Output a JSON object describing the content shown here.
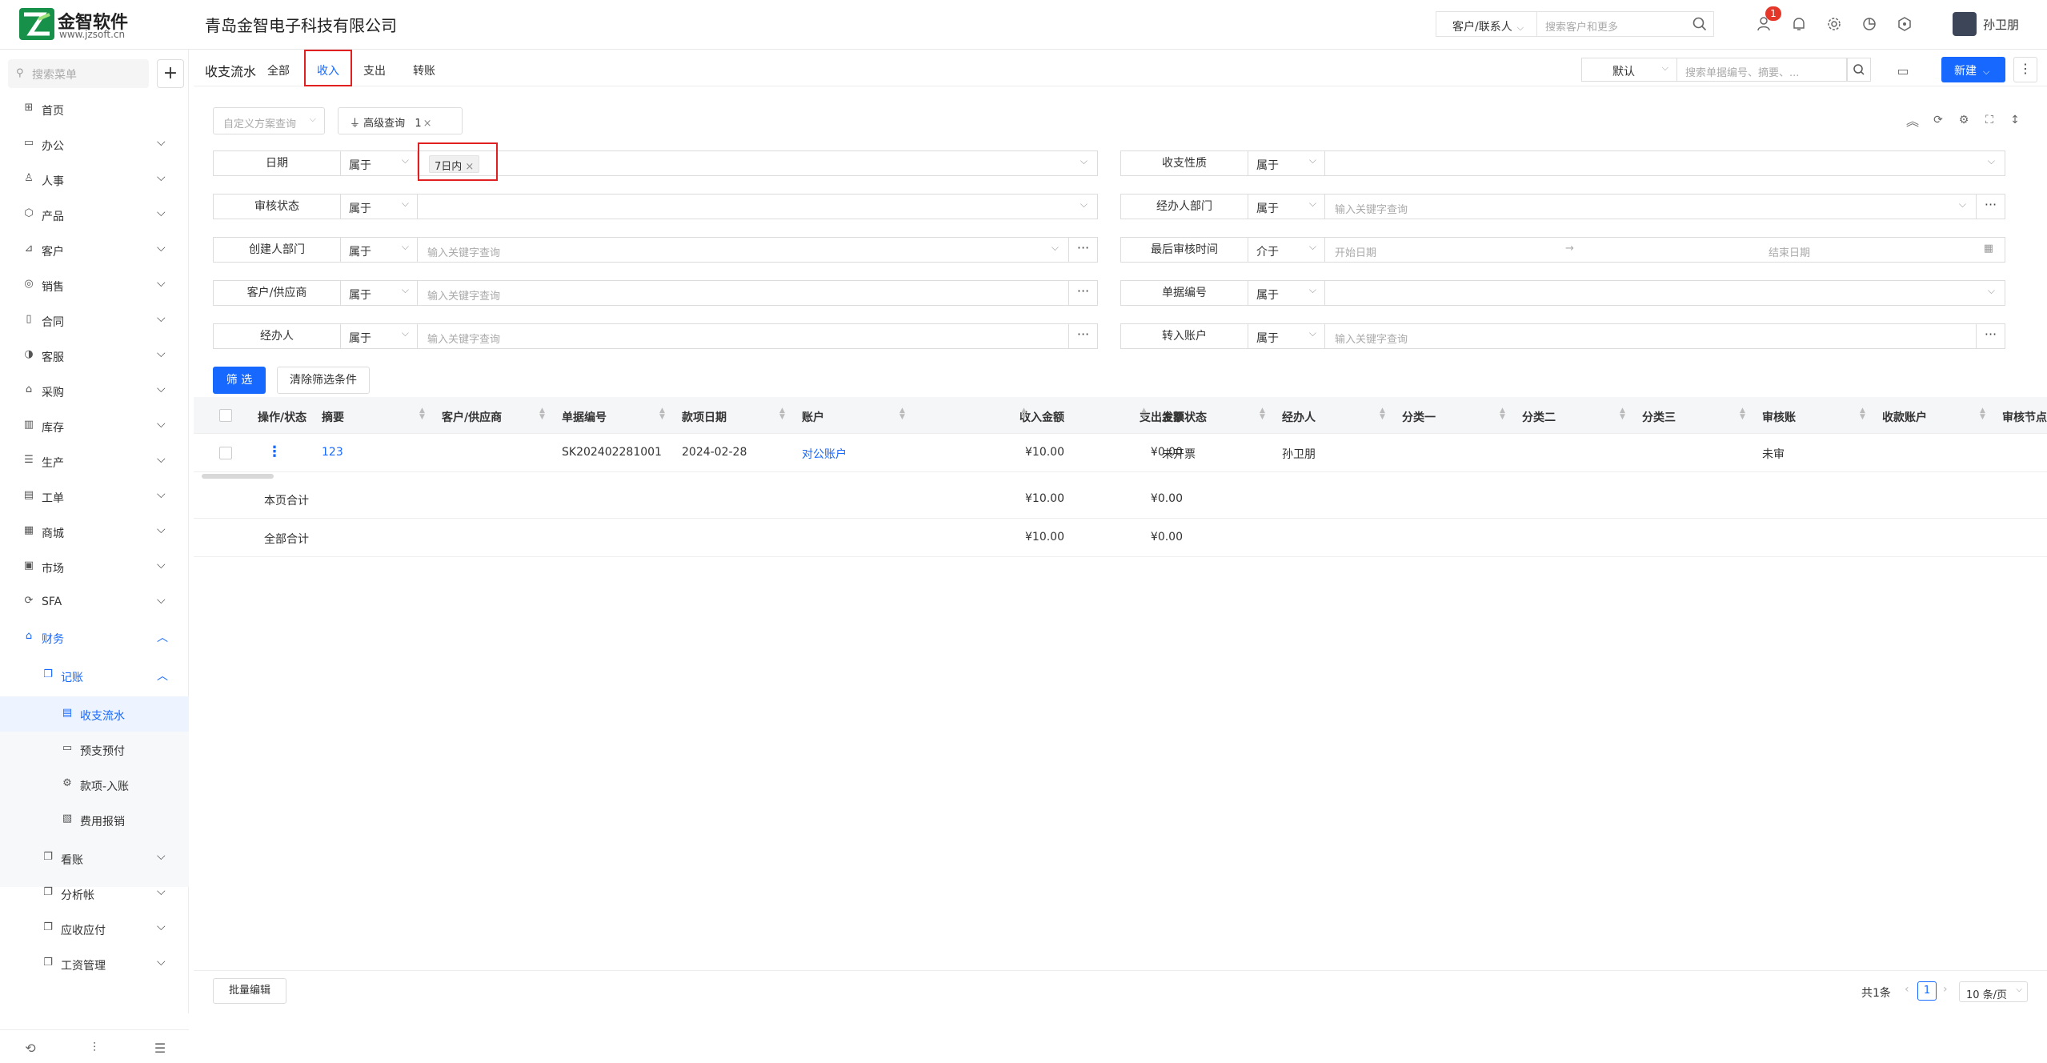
{
  "header": {
    "logo_title": "金智软件",
    "logo_sub": "www.jzsoft.cn",
    "company": "青岛金智电子科技有限公司",
    "search_scope": "客户/联系人",
    "search_placeholder": "搜索客户和更多",
    "notification_count": "1",
    "user_name": "孙卫朋"
  },
  "sidebar": {
    "search_placeholder": "搜索菜单",
    "items": [
      {
        "label": "首页",
        "icon": "home-icon"
      },
      {
        "label": "办公",
        "icon": "office-icon"
      },
      {
        "label": "人事",
        "icon": "people-icon"
      },
      {
        "label": "产品",
        "icon": "product-icon"
      },
      {
        "label": "客户",
        "icon": "customer-icon"
      },
      {
        "label": "销售",
        "icon": "sales-icon"
      },
      {
        "label": "合同",
        "icon": "contract-icon"
      },
      {
        "label": "客服",
        "icon": "support-icon"
      },
      {
        "label": "采购",
        "icon": "purchase-icon"
      },
      {
        "label": "库存",
        "icon": "inventory-icon"
      },
      {
        "label": "生产",
        "icon": "production-icon"
      },
      {
        "label": "工单",
        "icon": "workorder-icon"
      },
      {
        "label": "商城",
        "icon": "mall-icon"
      },
      {
        "label": "市场",
        "icon": "market-icon"
      },
      {
        "label": "SFA",
        "icon": "sfa-icon"
      },
      {
        "label": "财务",
        "icon": "finance-icon"
      }
    ],
    "finance_sub": {
      "label": "记账"
    },
    "ledger_items": [
      {
        "label": "收支流水"
      },
      {
        "label": "预支预付"
      },
      {
        "label": "款项-入账"
      },
      {
        "label": "费用报销"
      }
    ],
    "finance_more": [
      {
        "label": "看账"
      },
      {
        "label": "分析帐"
      },
      {
        "label": "应收应付"
      },
      {
        "label": "工资管理"
      }
    ]
  },
  "page": {
    "title": "收支流水",
    "tabs": [
      "全部",
      "收入",
      "支出",
      "转账"
    ],
    "view_select": "默认",
    "search_placeholder": "搜索单据编号、摘要、...",
    "new_label": "新建",
    "custom_query": "自定义方案查询",
    "advanced_query": "高级查询",
    "advanced_count": "1"
  },
  "filters": {
    "op_in": "属于",
    "op_between": "介于",
    "keyword_ph": "输入关键字查询",
    "start_ph": "开始日期",
    "end_ph": "结束日期",
    "left": [
      {
        "label": "日期",
        "tag": "7日内"
      },
      {
        "label": "审核状态"
      },
      {
        "label": "创建人部门"
      },
      {
        "label": "客户/供应商"
      },
      {
        "label": "经办人"
      }
    ],
    "right": [
      {
        "label": "收支性质"
      },
      {
        "label": "经办人部门"
      },
      {
        "label": "最后审核时间"
      },
      {
        "label": "单据编号"
      },
      {
        "label": "转入账户"
      }
    ],
    "submit": "筛 选",
    "clear": "清除筛选条件"
  },
  "table": {
    "headers": [
      "操作/状态",
      "摘要",
      "客户/供应商",
      "单据编号",
      "款项日期",
      "账户",
      "收入金额",
      "支出金额",
      "发票状态",
      "经办人",
      "分类一",
      "分类二",
      "分类三",
      "审核账",
      "收款账户",
      "审核节点"
    ],
    "row": {
      "summary": "123",
      "doc_no": "SK202402281001",
      "date": "2024-02-28",
      "account": "对公账户",
      "income": "¥10.00",
      "expense": "¥0.00",
      "invoice": "未开票",
      "handler": "孙卫朋",
      "audit": "未审"
    },
    "page_total_label": "本页合计",
    "page_total_income": "¥10.00",
    "page_total_expense": "¥0.00",
    "all_total_label": "全部合计",
    "all_total_income": "¥10.00",
    "all_total_expense": "¥0.00"
  },
  "footer": {
    "batch_edit": "批量编辑",
    "total_text": "共1条",
    "current_page": "1",
    "page_size": "10 条/页"
  },
  "colors": {
    "primary": "#1668ff",
    "highlight": "#e02020",
    "logo": "#17904a"
  }
}
